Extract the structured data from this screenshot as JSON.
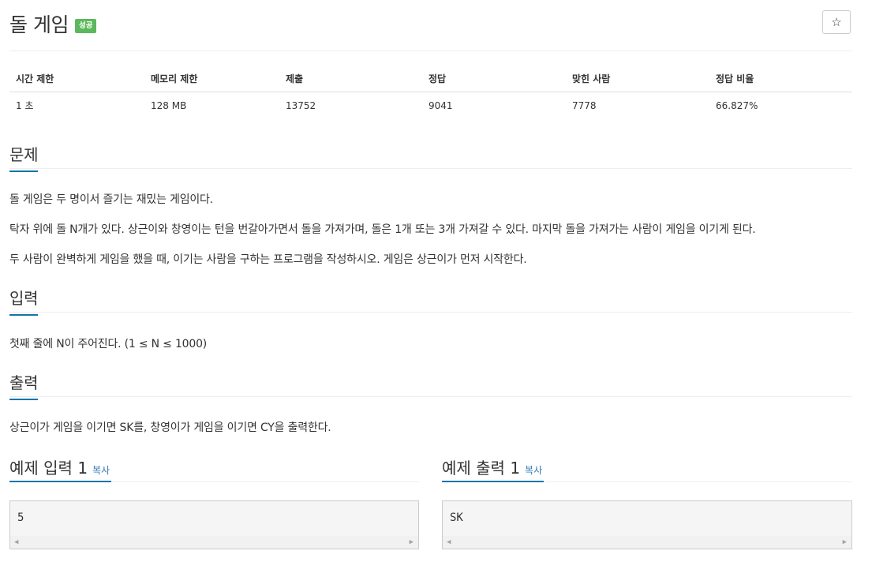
{
  "problem": {
    "title": "돌 게임",
    "result_badge": "성공",
    "star_symbol": "☆"
  },
  "info": {
    "headers": [
      "시간 제한",
      "메모리 제한",
      "제출",
      "정답",
      "맞힌 사람",
      "정답 비율"
    ],
    "values": [
      "1 초",
      "128 MB",
      "13752",
      "9041",
      "7778",
      "66.827%"
    ]
  },
  "sections": {
    "problem_heading": "문제",
    "problem_text": [
      "돌 게임은 두 명이서 즐기는 재밌는 게임이다.",
      "탁자 위에 돌 N개가 있다. 상근이와 창영이는 턴을 번갈아가면서 돌을 가져가며, 돌은 1개 또는 3개 가져갈 수 있다. 마지막 돌을 가져가는 사람이 게임을 이기게 된다.",
      "두 사람이 완벽하게 게임을 했을 때, 이기는 사람을 구하는 프로그램을 작성하시오. 게임은 상근이가 먼저 시작한다."
    ],
    "input_heading": "입력",
    "input_text": "첫째 줄에 N이 주어진다. (1 ≤ N ≤ 1000)",
    "output_heading": "출력",
    "output_text": "상근이가 게임을 이기면 SK를, 창영이가 게임을 이기면 CY을 출력한다."
  },
  "examples": {
    "input_title": "예제 입력 1",
    "output_title": "예제 출력 1",
    "copy_label": "복사",
    "input_value": "5",
    "output_value": "SK"
  },
  "colors": {
    "accent": "#0e76a8",
    "success": "#5cb85c",
    "link": "#337ab7"
  }
}
